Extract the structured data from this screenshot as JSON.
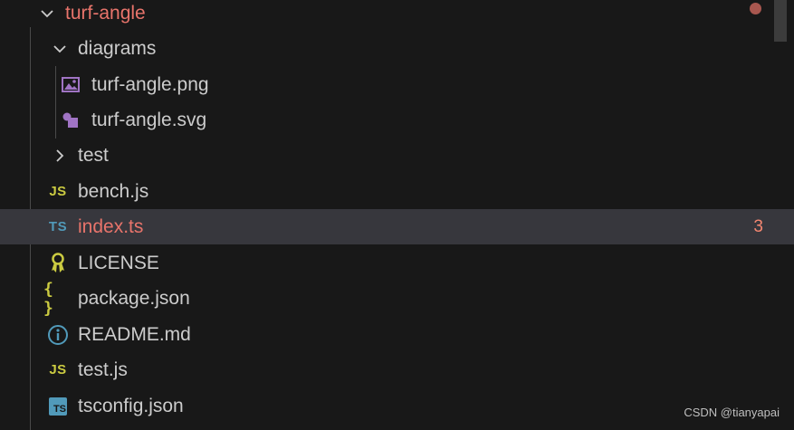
{
  "explorer": {
    "root": {
      "label": "turf-angle",
      "color": "#e8746b"
    },
    "items": [
      {
        "label": "diagrams",
        "icon": "chevron-down-icon"
      },
      {
        "label": "turf-angle.png",
        "icon": "image-icon"
      },
      {
        "label": "turf-angle.svg",
        "icon": "svg-icon"
      },
      {
        "label": "test",
        "icon": "chevron-right-icon"
      },
      {
        "label": "bench.js",
        "icon": "js-icon",
        "icon_text": "JS"
      },
      {
        "label": "index.ts",
        "icon": "ts-icon",
        "icon_text": "TS",
        "badge": "3",
        "selected": true,
        "color": "#e8746b"
      },
      {
        "label": "LICENSE",
        "icon": "license-icon"
      },
      {
        "label": "package.json",
        "icon": "json-icon",
        "icon_text": "{ }"
      },
      {
        "label": "README.md",
        "icon": "info-icon"
      },
      {
        "label": "test.js",
        "icon": "js-icon",
        "icon_text": "JS"
      },
      {
        "label": "tsconfig.json",
        "icon": "tsconfig-icon",
        "icon_text": "TS"
      }
    ]
  },
  "colors": {
    "background": "#181818",
    "selected_row": "#37373d",
    "text": "#cccccc",
    "error": "#e8746b",
    "js_yellow": "#cbcb41",
    "ts_blue": "#519aba",
    "svg_purple": "#a074c4"
  },
  "watermark": "CSDN @tianyapai"
}
